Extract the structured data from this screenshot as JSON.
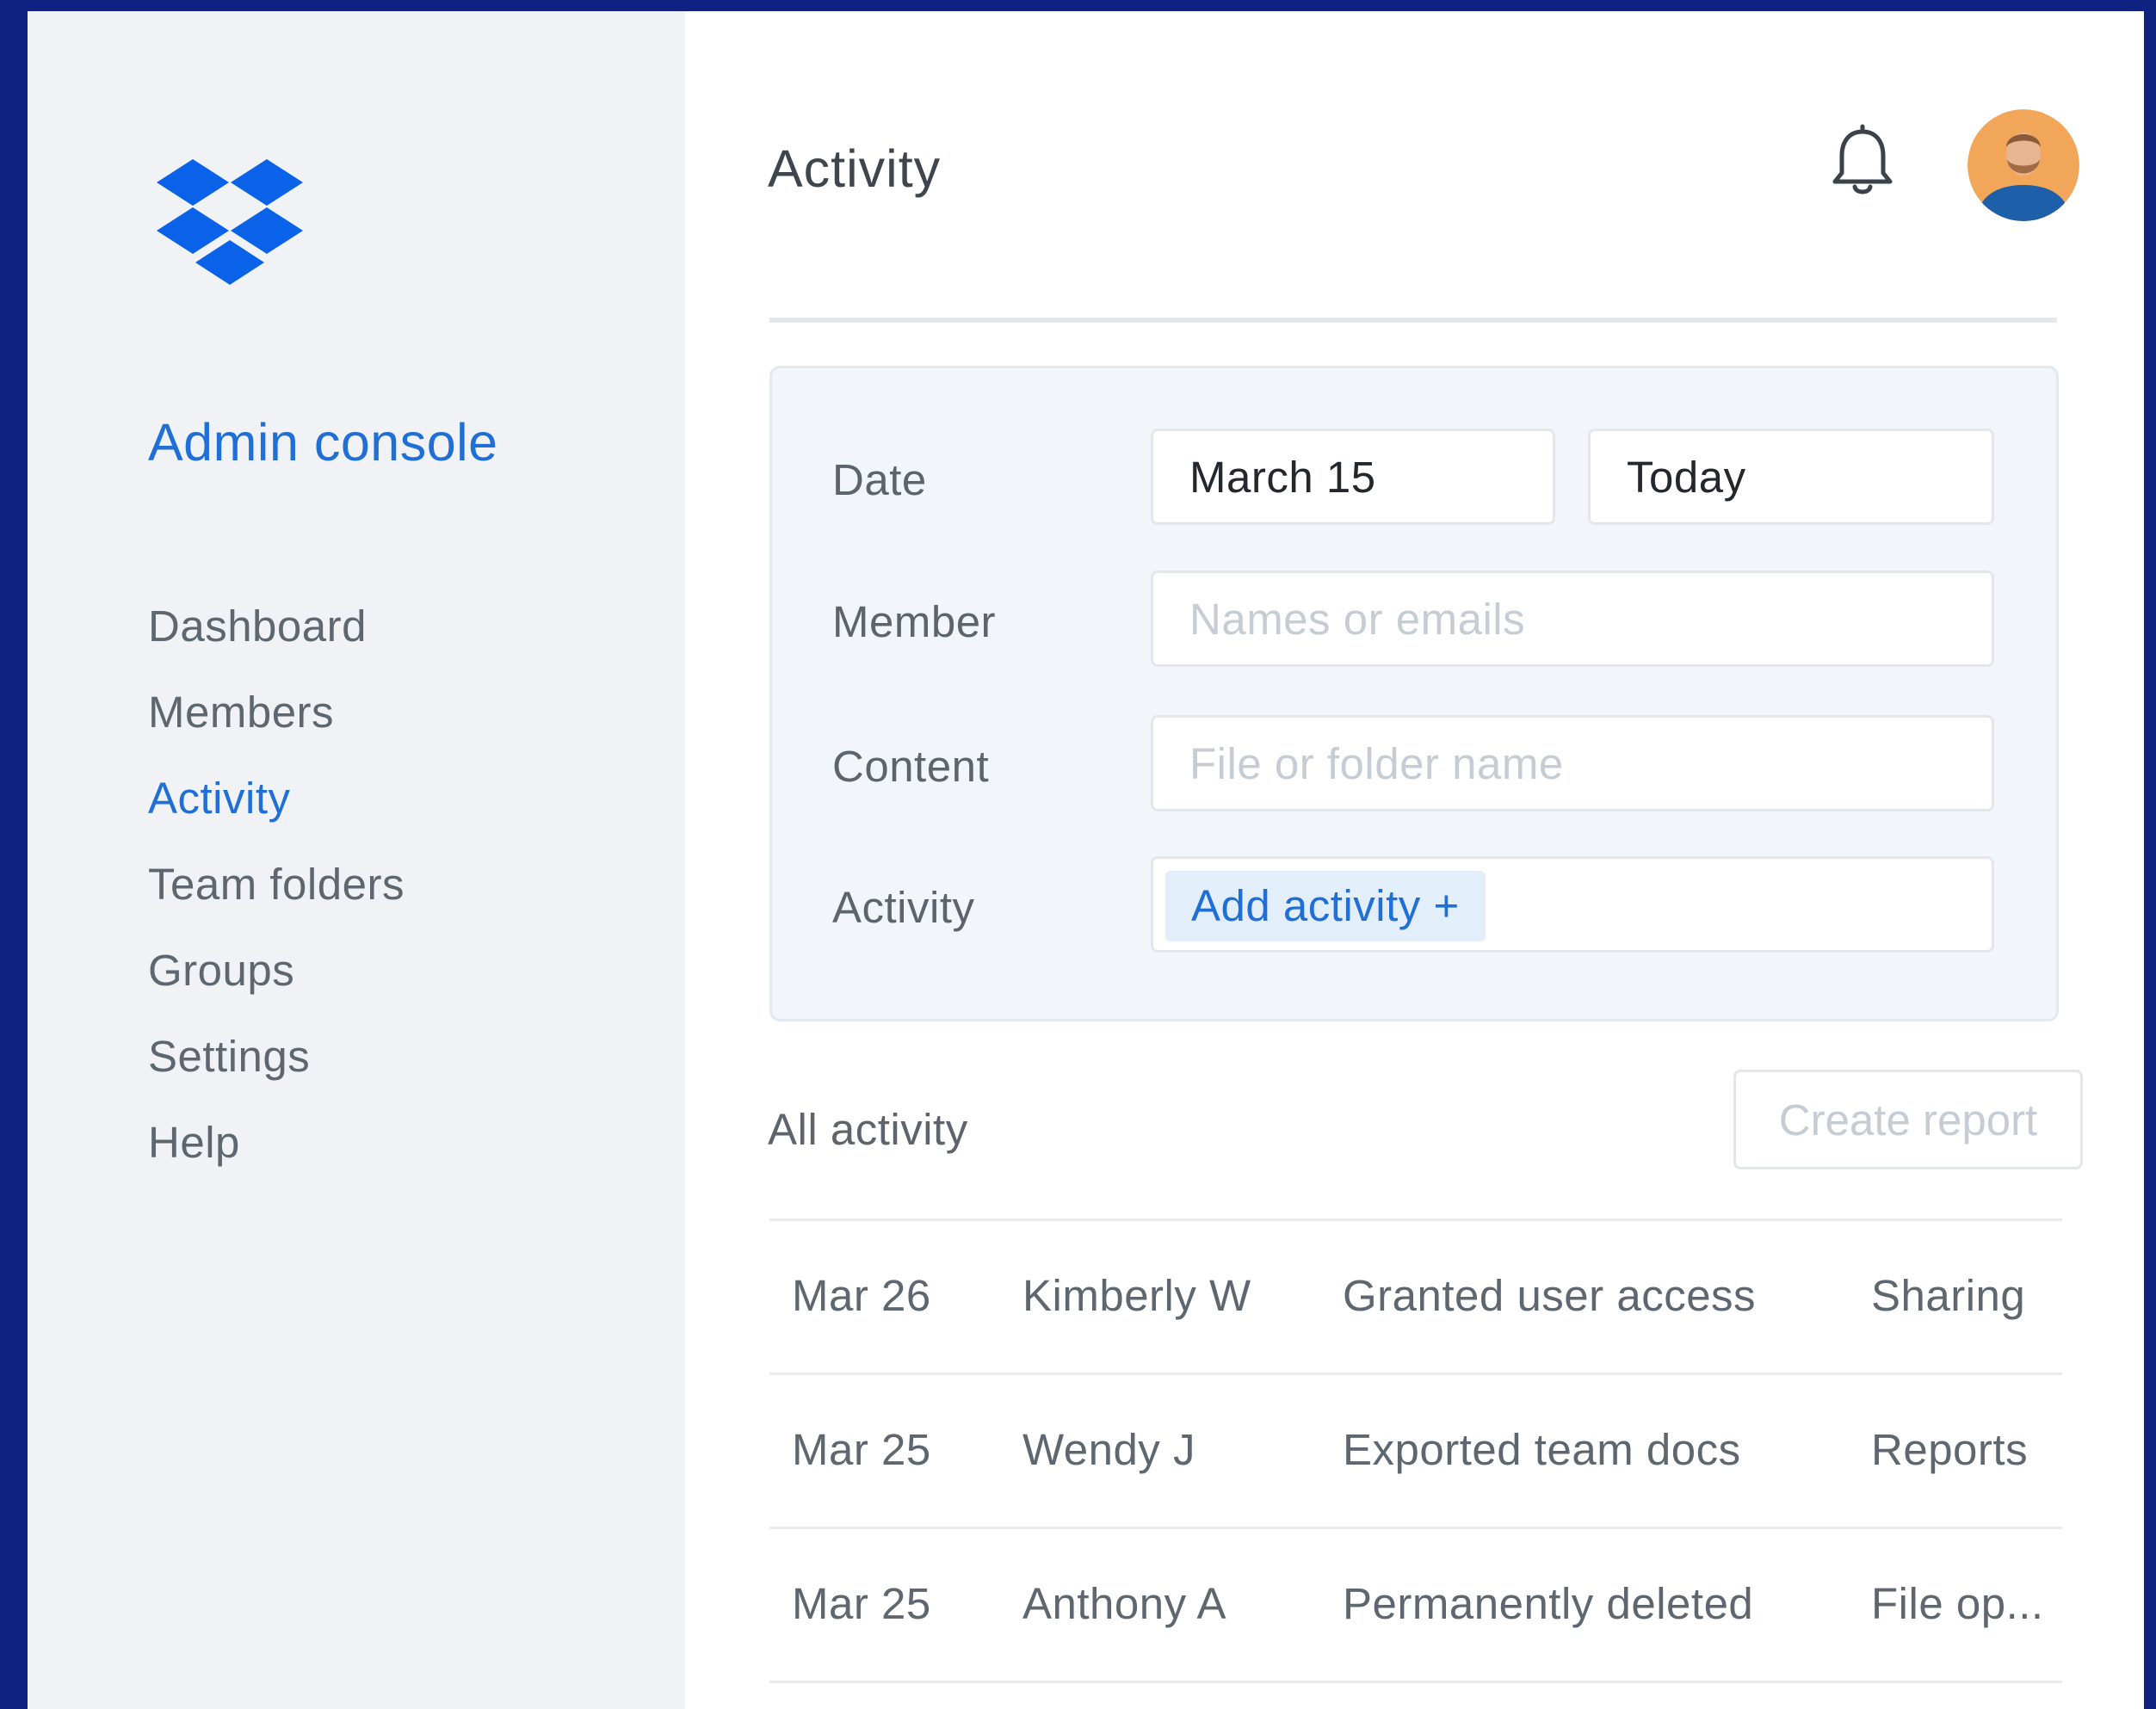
{
  "sidebar": {
    "logo": "dropbox-logo",
    "console_title": "Admin console",
    "items": [
      {
        "label": "Dashboard",
        "active": false
      },
      {
        "label": "Members",
        "active": false
      },
      {
        "label": "Activity",
        "active": true
      },
      {
        "label": "Team folders",
        "active": false
      },
      {
        "label": "Groups",
        "active": false
      },
      {
        "label": "Settings",
        "active": false
      },
      {
        "label": "Help",
        "active": false
      }
    ]
  },
  "header": {
    "title": "Activity",
    "notification_icon": "bell-icon",
    "avatar_icon": "user-avatar"
  },
  "filters": {
    "date": {
      "label": "Date",
      "from_value": "March 15",
      "to_value": "Today"
    },
    "member": {
      "label": "Member",
      "placeholder": "Names or emails",
      "value": ""
    },
    "content": {
      "label": "Content",
      "placeholder": "File or folder name",
      "value": ""
    },
    "activity": {
      "label": "Activity",
      "chip_label": "Add activity +"
    }
  },
  "activity_list": {
    "title": "All activity",
    "create_report_label": "Create report",
    "rows": [
      {
        "date": "Mar 26",
        "member": "Kimberly W",
        "action": "Granted user access",
        "category": "Sharing"
      },
      {
        "date": "Mar 25",
        "member": "Wendy J",
        "action": "Exported team docs",
        "category": "Reports"
      },
      {
        "date": "Mar 25",
        "member": "Anthony A",
        "action": "Permanently deleted",
        "category": "File op..."
      }
    ]
  },
  "colors": {
    "accent": "#1f6fd6",
    "frame": "#0f2181",
    "sidebar_bg": "#f0f2f5"
  }
}
